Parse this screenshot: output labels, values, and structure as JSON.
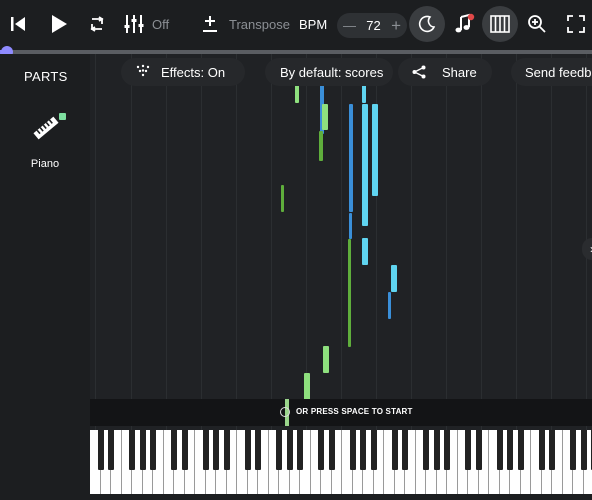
{
  "toolbar": {
    "mixer_label": "Off",
    "transpose_label": "Transpose",
    "bpm_label": "BPM",
    "bpm_minus": "—",
    "bpm_value": "72",
    "bpm_plus": "+"
  },
  "progress": {
    "fraction": 0.01
  },
  "sidebar": {
    "title": "PARTS",
    "parts": [
      {
        "label": "Piano",
        "color": "#7ee0a0"
      }
    ]
  },
  "pills": {
    "effects": "Effects: On",
    "default_view": "By default: scores",
    "share": "Share",
    "feedback": "Send feedb"
  },
  "start_prompt": "OR PRESS SPACE TO START",
  "colors": {
    "accent": "#8a86ff",
    "green_note": "#8ee07e",
    "dark_green_note": "#5fae3c",
    "cyan_note": "#5fd4f0",
    "blue_note": "#3a8fd9"
  },
  "icons": {
    "previous": "skip-back-icon",
    "play": "play-icon",
    "loop": "loop-icon",
    "mixer": "sliders-icon",
    "transpose": "plus-minus-icon",
    "night": "moon-icon",
    "notation": "music-note-icon",
    "piano_view": "piano-keys-icon",
    "zoom": "zoom-in-icon",
    "fullscreen": "fullscreen-icon",
    "effects": "sparkle-icon",
    "share": "share-icon",
    "part": "piano-icon"
  }
}
